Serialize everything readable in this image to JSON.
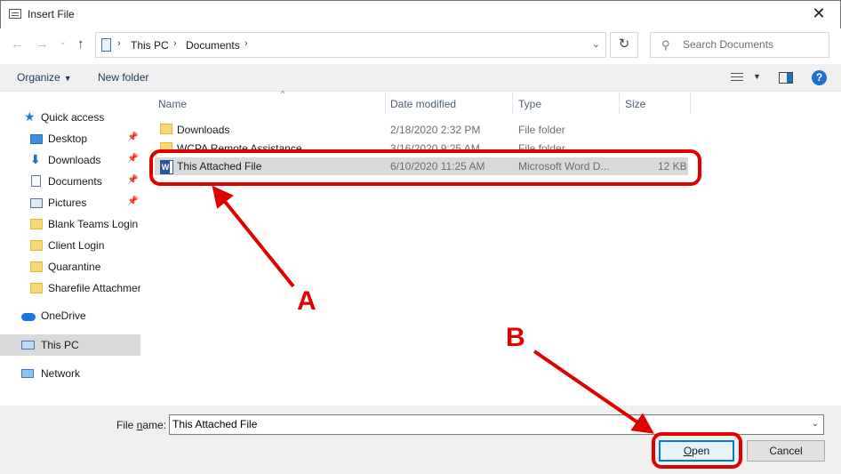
{
  "window": {
    "title": "Insert File",
    "close_glyph": "✕"
  },
  "address": {
    "back_glyph": "←",
    "forward_glyph": "→",
    "recent_glyph": "⌄",
    "up_glyph": "↑",
    "path": [
      "This PC",
      "Documents"
    ],
    "dropdown_glyph": "⌄",
    "refresh_glyph": "↻",
    "search_placeholder": "Search Documents",
    "search_glyph": "⚲"
  },
  "toolbar": {
    "organize_label": "Organize",
    "new_folder_label": "New folder",
    "help_label": "?"
  },
  "nav": {
    "pin_glyph": "📌",
    "star_glyph": "★",
    "download_glyph": "⬇",
    "items": [
      {
        "label": "Quick access",
        "icon": "star-icon"
      },
      {
        "label": "Desktop",
        "icon": "desktop-icon",
        "pinned": true
      },
      {
        "label": "Downloads",
        "icon": "download-icon",
        "pinned": true
      },
      {
        "label": "Documents",
        "icon": "documents-icon",
        "pinned": true
      },
      {
        "label": "Pictures",
        "icon": "pictures-icon",
        "pinned": true
      },
      {
        "label": "Blank Teams Login",
        "icon": "folder-icon"
      },
      {
        "label": "Client Login",
        "icon": "folder-icon"
      },
      {
        "label": "Quarantine",
        "icon": "folder-icon"
      },
      {
        "label": "Sharefile Attachmer",
        "icon": "folder-icon"
      },
      {
        "label": "OneDrive",
        "icon": "onedrive-icon"
      },
      {
        "label": "This PC",
        "icon": "this-pc-icon",
        "selected": true
      },
      {
        "label": "Network",
        "icon": "network-icon"
      }
    ]
  },
  "columns": {
    "name": "Name",
    "date": "Date modified",
    "type": "Type",
    "size": "Size",
    "sort_glyph": "^"
  },
  "files": [
    {
      "name": "Downloads",
      "date": "2/18/2020 2:32 PM",
      "type": "File folder",
      "size": "",
      "icon": "folder-icon"
    },
    {
      "name": "WCPA Remote Assistance",
      "date": "3/16/2020 9:25 AM",
      "type": "File folder",
      "size": "",
      "icon": "folder-icon"
    },
    {
      "name": "This Attached File",
      "date": "6/10/2020 11:25 AM",
      "type": "Microsoft Word D...",
      "size": "12 KB",
      "icon": "word-document-icon",
      "word_letter": "W",
      "selected": true
    }
  ],
  "filename": {
    "label_prefix": "File ",
    "label_underline": "n",
    "label_suffix": "ame:",
    "value": "This Attached File",
    "dropdown_glyph": "⌄"
  },
  "buttons": {
    "open_underline": "O",
    "open_rest": "pen",
    "cancel": "Cancel"
  },
  "annotations": {
    "a_label": "A",
    "b_label": "B",
    "color": "#e00000"
  }
}
